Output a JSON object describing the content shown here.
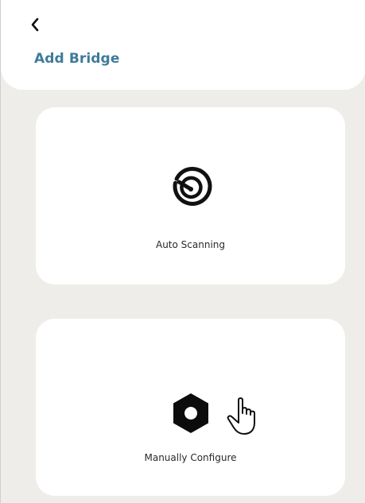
{
  "header": {
    "title": "Add Bridge"
  },
  "options": [
    {
      "label": "Auto Scanning"
    },
    {
      "label": "Manually Configure"
    }
  ],
  "colors": {
    "title": "#3f7b9b",
    "background": "#efedea",
    "card": "#ffffff"
  },
  "icons": {
    "back": "chevron-left-icon",
    "scan": "radar-scan-icon",
    "configure": "hex-nut-icon",
    "cursor": "hand-pointer-icon"
  }
}
